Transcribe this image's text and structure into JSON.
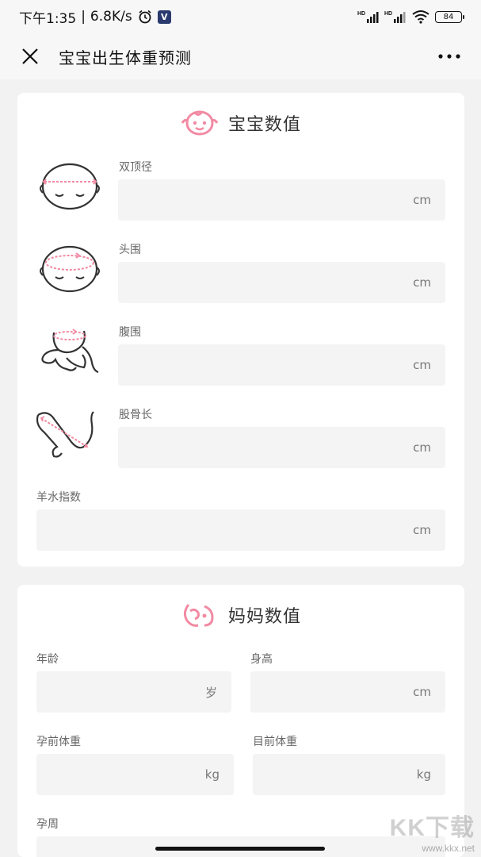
{
  "status_bar": {
    "time": "下午1:35",
    "separator": "|",
    "net_speed": "6.8K/s",
    "vpn_badge": "V",
    "battery": "84",
    "icons": [
      "alarm-icon",
      "vpn-icon",
      "hd-signal-icon",
      "hd-signal-icon",
      "wifi-icon",
      "battery-icon"
    ]
  },
  "nav": {
    "title": "宝宝出生体重预测",
    "close_icon": "close-icon",
    "more_icon": "more-icon"
  },
  "baby_section": {
    "title": "宝宝数值",
    "icon": "baby-face-icon",
    "fields": [
      {
        "label": "双顶径",
        "value": "",
        "unit": "cm",
        "illustration": "head-width-illustration"
      },
      {
        "label": "头围",
        "value": "",
        "unit": "cm",
        "illustration": "head-circumference-illustration"
      },
      {
        "label": "腹围",
        "value": "",
        "unit": "cm",
        "illustration": "abdominal-circumference-illustration"
      },
      {
        "label": "股骨长",
        "value": "",
        "unit": "cm",
        "illustration": "femur-length-illustration"
      },
      {
        "label": "羊水指数",
        "value": "",
        "unit": "cm"
      }
    ]
  },
  "mom_section": {
    "title": "妈妈数值",
    "icon": "mom-icon",
    "fields": [
      {
        "label": "年龄",
        "value": "",
        "unit": "岁"
      },
      {
        "label": "身高",
        "value": "",
        "unit": "cm"
      },
      {
        "label": "孕前体重",
        "value": "",
        "unit": "kg"
      },
      {
        "label": "目前体重",
        "value": "",
        "unit": "kg"
      },
      {
        "label": "孕周",
        "value": "",
        "unit": ""
      }
    ]
  },
  "watermark": {
    "logo": "KK下载",
    "url": "www.kkx.net"
  },
  "colors": {
    "accent_pink": "#f28aa3",
    "background": "#f2f2f2",
    "field_bg": "#f4f4f4"
  }
}
